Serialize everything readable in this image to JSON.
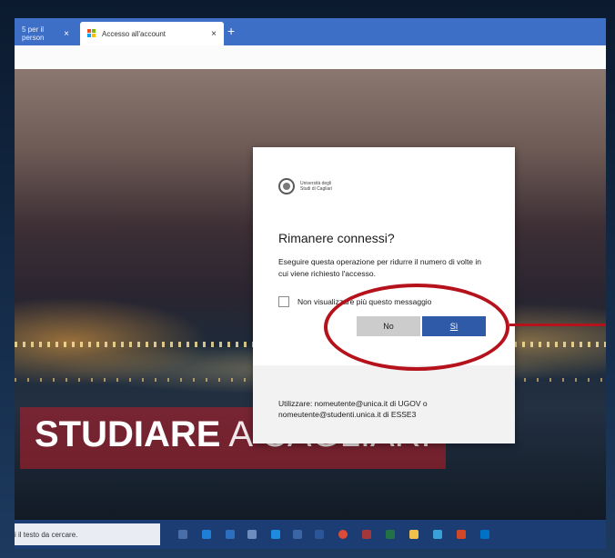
{
  "browser": {
    "tabs": [
      {
        "label": "5 per il person",
        "active": false
      },
      {
        "label": "Accesso all'account",
        "active": true
      }
    ],
    "close_glyph": "×",
    "new_tab_glyph": "+"
  },
  "dialog": {
    "logo_text": "Università degli Studi di Cagliari",
    "title": "Rimanere connessi?",
    "description": "Eseguire questa operazione per ridurre il numero di volte in cui viene richiesto l'accesso.",
    "checkbox_label": "Non visualizzare più questo messaggio",
    "checkbox_checked": false,
    "no_label": "No",
    "yes_label": "Sì",
    "footer_text": "Utilizzare: nomeutente@unica.it di UGOV o nomeutente@studenti.unica.it di ESSE3"
  },
  "background": {
    "banner_bold": "STUDIARE",
    "banner_thin": " A CAGLIARI"
  },
  "taskbar": {
    "search_placeholder": "i il testo da cercare.",
    "icons": [
      "task-view-icon",
      "edge-icon",
      "store-icon",
      "briefcase-icon",
      "ie-icon",
      "mail-icon",
      "word-icon",
      "chrome-icon",
      "access-icon",
      "excel-icon",
      "explorer-icon",
      "publisher-icon",
      "powerpoint-icon",
      "outlook-icon"
    ]
  },
  "colors": {
    "tab_bar": "#3e6fc6",
    "primary_button": "#2f5aa8",
    "annotation": "#b5121b",
    "taskbar": "#1b3d73"
  }
}
